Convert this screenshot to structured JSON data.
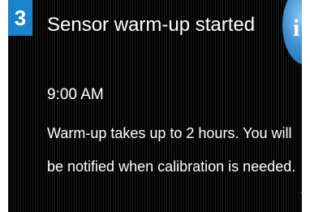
{
  "step": {
    "number": "3",
    "badge_color": "#1a83c9"
  },
  "screen": {
    "background_color": "#000000",
    "text_color": "#ffffff"
  },
  "info_button": {
    "icon": "info-icon",
    "glyph": "i",
    "color": "#3d8fd0"
  },
  "alert": {
    "title": "Sensor warm-up started",
    "time": "9:00 AM",
    "message": "Warm-up takes up to 2 hours. You will be notified when calibration is needed."
  },
  "scroll": {
    "icon": "scroll-down-arrow-icon"
  }
}
